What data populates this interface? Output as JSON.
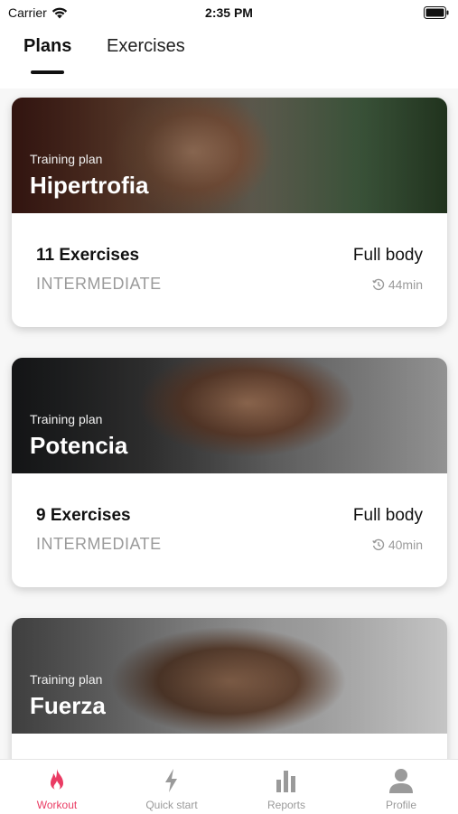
{
  "status": {
    "carrier": "Carrier",
    "time": "2:35 PM"
  },
  "tabs": [
    {
      "label": "Plans",
      "active": true
    },
    {
      "label": "Exercises",
      "active": false
    }
  ],
  "plans": [
    {
      "subtitle": "Training plan",
      "title": "Hipertrofia",
      "exercises": "11 Exercises",
      "level": "INTERMEDIATE",
      "target": "Full body",
      "duration": "44min"
    },
    {
      "subtitle": "Training plan",
      "title": "Potencia",
      "exercises": "9 Exercises",
      "level": "INTERMEDIATE",
      "target": "Full body",
      "duration": "40min"
    },
    {
      "subtitle": "Training plan",
      "title": "Fuerza"
    }
  ],
  "bottom_nav": [
    {
      "label": "Workout",
      "icon": "flame-icon",
      "active": true
    },
    {
      "label": "Quick start",
      "icon": "lightning-icon",
      "active": false
    },
    {
      "label": "Reports",
      "icon": "bar-chart-icon",
      "active": false
    },
    {
      "label": "Profile",
      "icon": "person-icon",
      "active": false
    }
  ],
  "colors": {
    "accent": "#ea3b63",
    "inactive": "#9a9a9a"
  }
}
